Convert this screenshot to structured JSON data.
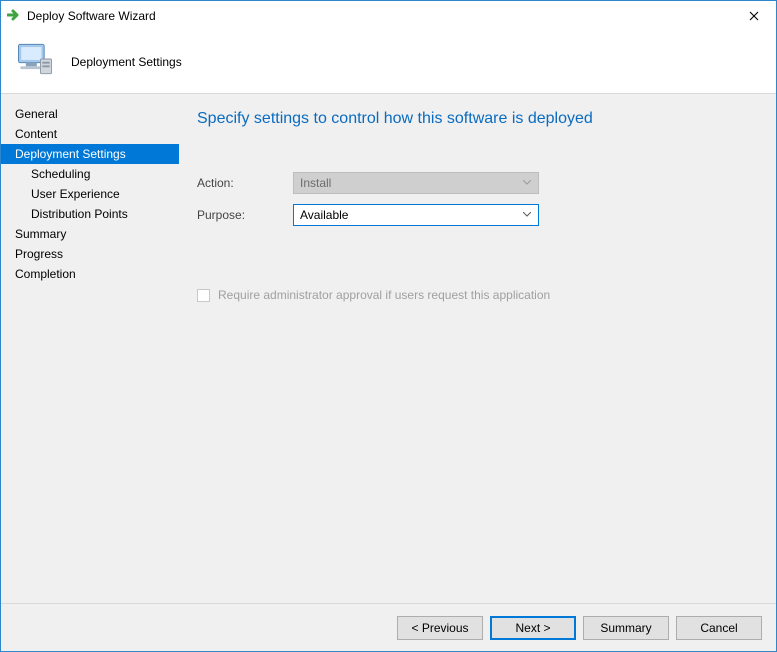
{
  "window": {
    "title": "Deploy Software Wizard"
  },
  "header": {
    "page_title": "Deployment Settings"
  },
  "sidebar": {
    "items": [
      {
        "label": "General",
        "sub": false,
        "selected": false
      },
      {
        "label": "Content",
        "sub": false,
        "selected": false
      },
      {
        "label": "Deployment Settings",
        "sub": false,
        "selected": true
      },
      {
        "label": "Scheduling",
        "sub": true,
        "selected": false
      },
      {
        "label": "User Experience",
        "sub": true,
        "selected": false
      },
      {
        "label": "Distribution Points",
        "sub": true,
        "selected": false
      },
      {
        "label": "Summary",
        "sub": false,
        "selected": false
      },
      {
        "label": "Progress",
        "sub": false,
        "selected": false
      },
      {
        "label": "Completion",
        "sub": false,
        "selected": false
      }
    ]
  },
  "main": {
    "heading": "Specify settings to control how this software is deployed",
    "action_label": "Action:",
    "action_value": "Install",
    "purpose_label": "Purpose:",
    "purpose_value": "Available",
    "approval_label": "Require administrator approval if users request this application"
  },
  "footer": {
    "previous": "< Previous",
    "next": "Next >",
    "summary": "Summary",
    "cancel": "Cancel"
  }
}
